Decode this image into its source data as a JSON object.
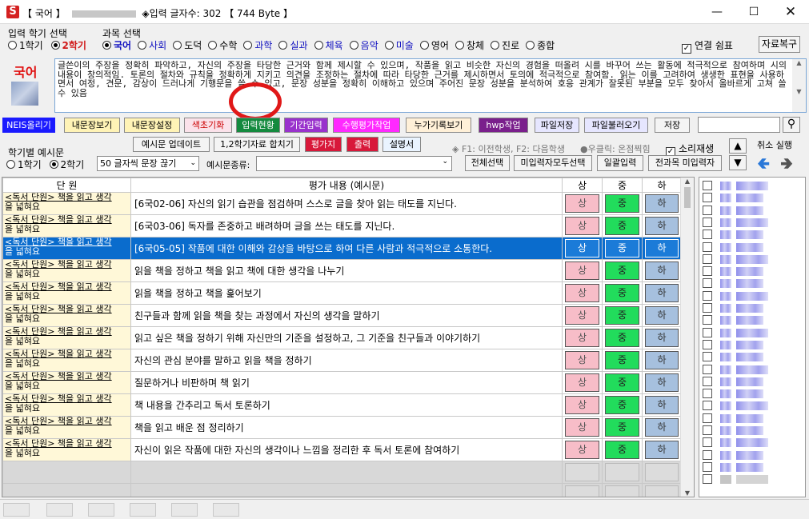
{
  "title": {
    "bracket_open": "【 국어 】",
    "count_label": "◈입력 글자수: 302",
    "bytes_label": "【 744 Byte 】"
  },
  "semester": {
    "legend": "입력 학기 선택",
    "opt1": "1학기",
    "opt2": "2학기",
    "selected": "2학기"
  },
  "subject": {
    "legend": "과목 선택",
    "items": [
      "국어",
      "사회",
      "도덕",
      "수학",
      "과학",
      "실과",
      "체육",
      "음악",
      "미술",
      "영어",
      "창체",
      "진로",
      "종합"
    ],
    "selected": "국어"
  },
  "link_check": {
    "label": "연결 쉼표",
    "checked": true
  },
  "restore_button": "자료복구",
  "subject_label": "국어",
  "text_area": "글쓴이의 주장을 정확히 파악하고, 자신의 주장을 타당한 근거와 함께 제시할 수 있으며, 작품을 읽고 비슷한 자신의 경험을 떠올려 시를 바꾸어 쓰는 활동에 적극적으로 참여하며 시의 내용이 창의적임. 토론의 절차와 규칙을 정확하게 지키고 의견을 조정하는 절차에 따라 타당한 근거를 제시하면서 토의에 적극적으로 참여함. 읽는 이를 고려하여 생생한 표현을 사용하면서 여정, 견문, 감상이 드러나게 기행문을 쓸 수 있고, 문장 성분을 정확히 이해하고 있으며 주어진 문장 성분을 분석하여 호응 관계가 잘못된 부분을 모두 찾아서 올바르게 고쳐 쓸 수 있음",
  "toolbar1": {
    "neis": "NEIS올리기",
    "view": "내문장보기",
    "setting": "내문장설정",
    "color_reset": "색초기화",
    "input_status": "입력현황",
    "period_input": "기간입력",
    "perf_eval": "수행평가작업",
    "cumulative": "누가기록보기",
    "hwp": "hwp작업",
    "file_save": "파일저장",
    "file_load": "파일불러오기",
    "save": "저장"
  },
  "sem_example": {
    "legend": "학기별 예시문",
    "opt1": "1학기",
    "opt2": "2학기",
    "selected": "2학기"
  },
  "toolbar2": {
    "update": "예시문 업데이트",
    "merge": "1,2학기자료 합치기",
    "eval_count": "평가지",
    "print": "출력",
    "manual": "설명서"
  },
  "hint": "◈ F1: 이전학생, F2: 다음학생",
  "hint2": "●우클릭: 온점찍힘",
  "sound": {
    "label": "소리재생",
    "checked": true
  },
  "undo": "취소 실행",
  "truncate_select": "50 글자씩 문장 끊기",
  "example_type_label": "예시문종류:",
  "toolbar3": {
    "select_all": "전체선택",
    "non_input_all": "미입력자모두선택",
    "bulk_input": "일괄입력",
    "all_subject_non_input": "전과목 미입력자"
  },
  "table": {
    "headers": {
      "unit": "단 원",
      "eval": "평가 내용 (예시문)",
      "s": "상",
      "j": "중",
      "h": "하"
    },
    "grade_s": "상",
    "grade_j": "중",
    "grade_h": "하",
    "rows": [
      {
        "unit_a": "<독서 단원> 책을 읽고 생각",
        "unit_b": "을 넓혀요",
        "text": "[6국02-06] 자신의 읽기 습관을 점검하며 스스로 글을 찾아 읽는 태도를 지닌다."
      },
      {
        "unit_a": "<독서 단원> 책을 읽고 생각",
        "unit_b": "을 넓혀요",
        "text": "[6국03-06] 독자를 존중하고 배려하며 글을 쓰는 태도를 지닌다."
      },
      {
        "unit_a": "<독서 단원> 책을 읽고 생각",
        "unit_b": "을 넓혀요",
        "text": "[6국05-05] 작품에 대한 이해와 감상을 바탕으로 하여 다른 사람과 적극적으로 소통한다."
      },
      {
        "unit_a": "<독서 단원> 책을 읽고 생각",
        "unit_b": "을 넓혀요",
        "text": "읽을 책을 정하고 책을 읽고 책에 대한 생각을 나누기"
      },
      {
        "unit_a": "<독서 단원> 책을 읽고 생각",
        "unit_b": "을 넓혀요",
        "text": "읽을 책을 정하고 책을 훑어보기"
      },
      {
        "unit_a": "<독서 단원> 책을 읽고 생각",
        "unit_b": "을 넓혀요",
        "text": "친구들과 함께 읽을 책을 찾는 과정에서 자신의 생각을 말하기"
      },
      {
        "unit_a": "<독서 단원> 책을 읽고 생각",
        "unit_b": "을 넓혀요",
        "text": "읽고 싶은 책을 정하기 위해 자신만의 기준을 설정하고, 그 기준을 친구들과 이야기하기"
      },
      {
        "unit_a": "<독서 단원> 책을 읽고 생각",
        "unit_b": "을 넓혀요",
        "text": "자신의 관심 분야를 말하고 읽을 책을 정하기"
      },
      {
        "unit_a": "<독서 단원> 책을 읽고 생각",
        "unit_b": "을 넓혀요",
        "text": "질문하거나 비판하며 책 읽기"
      },
      {
        "unit_a": "<독서 단원> 책을 읽고 생각",
        "unit_b": "을 넓혀요",
        "text": "책 내용을 간추리고 독서 토론하기"
      },
      {
        "unit_a": "<독서 단원> 책을 읽고 생각",
        "unit_b": "을 넓혀요",
        "text": "책을 읽고 배운 점 정리하기"
      },
      {
        "unit_a": "<독서 단원> 책을 읽고 생각",
        "unit_b": "을 넓혀요",
        "text": "자신이 읽은 작품에 대한 자신의 생각이나 느낌을 정리한 후 독서 토론에 참여하기"
      }
    ],
    "selected_row": 3
  },
  "colors": {
    "highlight": "#0a6ccd",
    "grade_s": "#f7bdc8",
    "grade_j": "#22dc5c",
    "grade_h": "#a6c0de",
    "unit_bg": "#fff8d8"
  },
  "icons": [
    "app-icon",
    "minimize-icon",
    "maximize-icon",
    "close-icon",
    "search-icon",
    "arrow-up-icon",
    "arrow-down-icon",
    "undo-arrow-icon",
    "redo-arrow-icon"
  ]
}
